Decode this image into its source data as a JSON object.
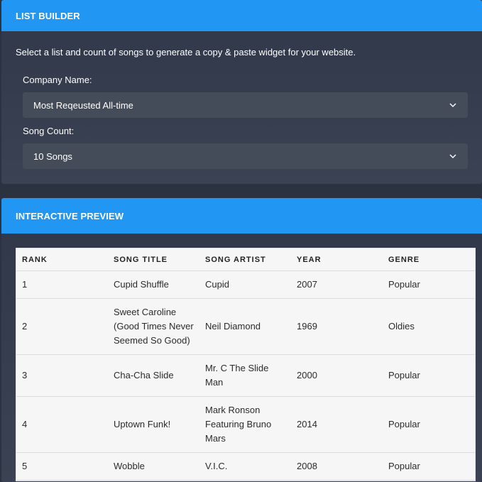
{
  "builder": {
    "header": "LIST BUILDER",
    "intro": "Select a list and count of songs to generate a copy & paste widget for your website.",
    "company_label": "Company Name:",
    "company_value": "Most Reqeusted All-time",
    "count_label": "Song Count:",
    "count_value": "10 Songs"
  },
  "preview": {
    "header": "INTERACTIVE PREVIEW",
    "columns": [
      "RANK",
      "SONG TITLE",
      "SONG ARTIST",
      "YEAR",
      "GENRE"
    ],
    "rows": [
      [
        "1",
        "Cupid Shuffle",
        "Cupid",
        "2007",
        "Popular"
      ],
      [
        "2",
        "Sweet Caroline (Good Times Never Seemed So Good)",
        "Neil Diamond",
        "1969",
        "Oldies"
      ],
      [
        "3",
        "Cha-Cha Slide",
        "Mr. C The Slide Man",
        "2000",
        "Popular"
      ],
      [
        "4",
        "Uptown Funk!",
        "Mark Ronson Featuring Bruno Mars",
        "2014",
        "Popular"
      ],
      [
        "5",
        "Wobble",
        "V.I.C.",
        "2008",
        "Popular"
      ]
    ]
  },
  "colors": {
    "accent": "#2196f3",
    "background": "#2b3240",
    "select_bg": "#444b59"
  }
}
